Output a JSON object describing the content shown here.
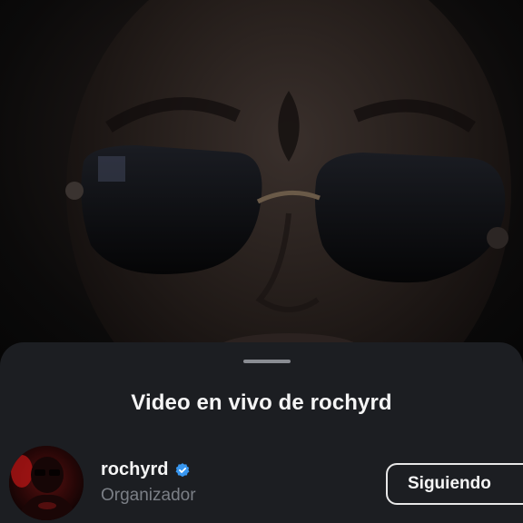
{
  "live_sheet": {
    "title": "Video en vivo de rochyrd",
    "organizer": {
      "username": "rochyrd",
      "verified": true,
      "role": "Organizador"
    },
    "follow_button_label": "Siguiendo"
  },
  "colors": {
    "sheet_background": "#1c1e22",
    "verified_badge": "#3897f0",
    "secondary_text": "#7b7f86",
    "primary_text": "#f5f5f5"
  }
}
